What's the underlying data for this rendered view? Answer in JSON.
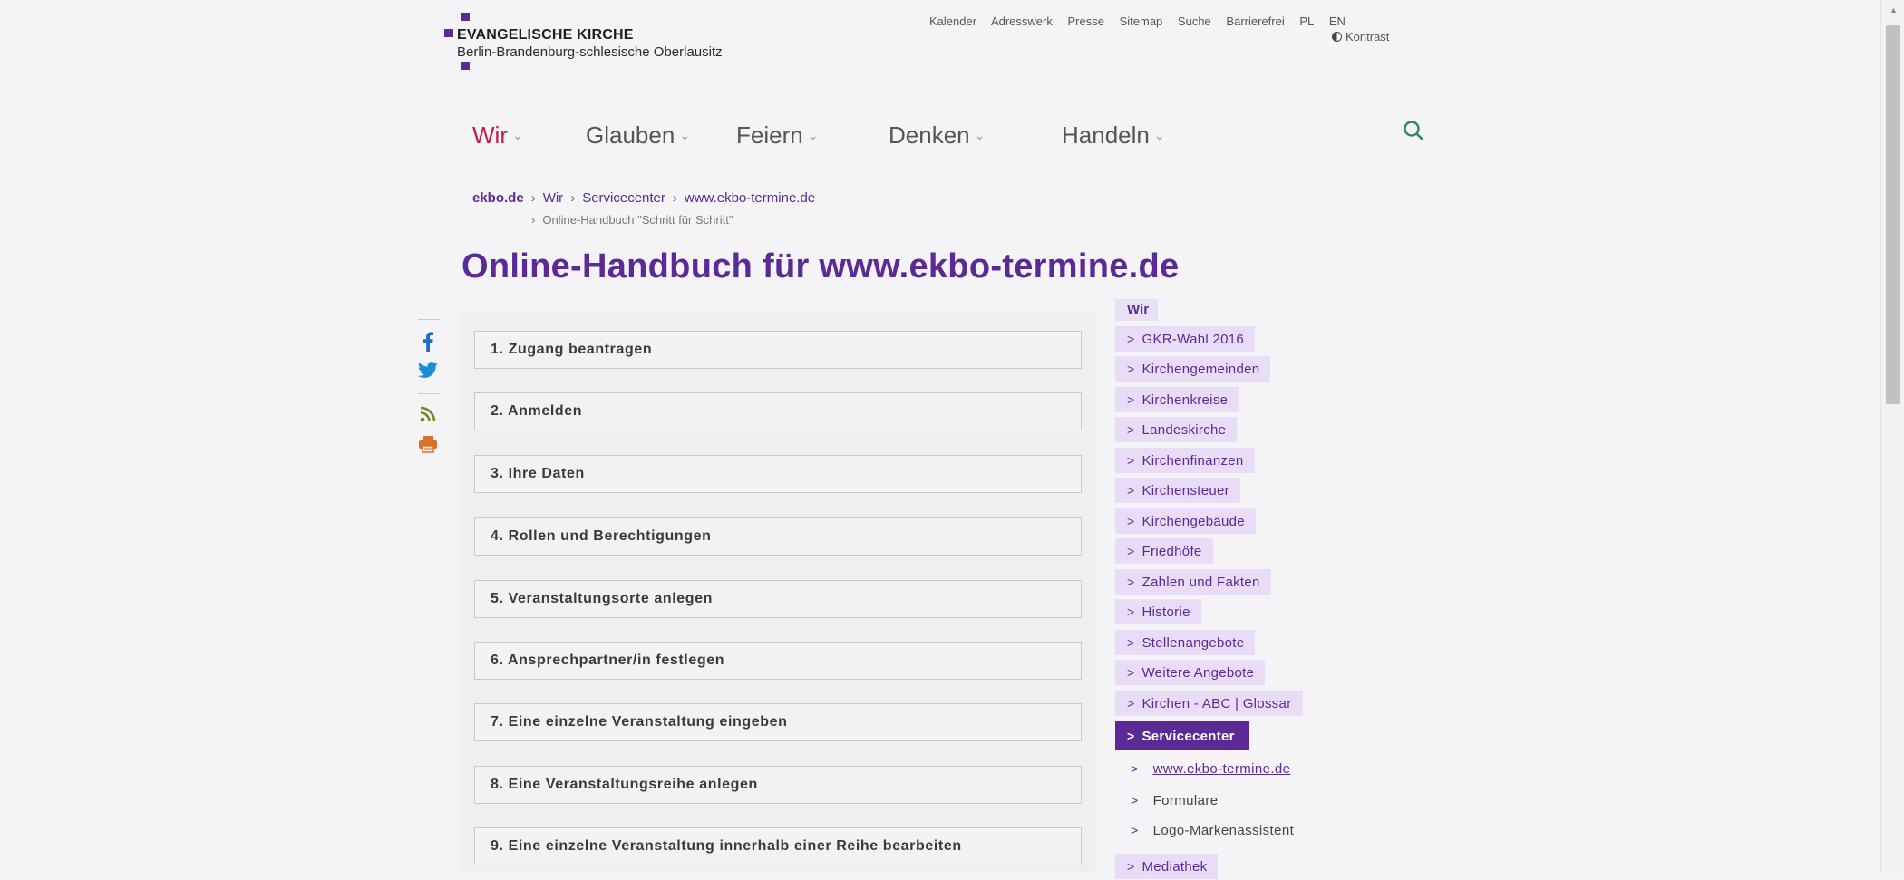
{
  "logo": {
    "name": "EVANGELISCHE KIRCHE",
    "subtitle": "Berlin-Brandenburg-schlesische Oberlausitz",
    "color": "#5b2a96"
  },
  "toplinks": [
    "Kalender",
    "Adresswerk",
    "Presse",
    "Sitemap",
    "Suche",
    "Barrierefrei",
    "PL",
    "EN"
  ],
  "kontrast": "Kontrast",
  "nav": [
    {
      "label": "Wir",
      "active": true
    },
    {
      "label": "Glauben",
      "active": false
    },
    {
      "label": "Feiern",
      "active": false
    },
    {
      "label": "Denken",
      "active": false
    },
    {
      "label": "Handeln",
      "active": false
    }
  ],
  "nav_chevron": "⌄",
  "search_icon": "search-icon",
  "breadcrumb": {
    "items": [
      "ekbo.de",
      "Wir",
      "Servicecenter",
      "www.ekbo-termine.de"
    ],
    "sep": "›",
    "current": "Online-Handbuch \"Schritt für Schritt\""
  },
  "page_title": "Online-Handbuch für www.ekbo-termine.de",
  "social_icons": [
    "facebook-icon",
    "twitter-icon",
    "rss-icon",
    "print-icon"
  ],
  "accordion": [
    "1. Zugang beantragen",
    "2. Anmelden",
    "3. Ihre Daten",
    "4. Rollen und Berechtigungen",
    "5. Veranstaltungsorte anlegen",
    "6. Ansprechpartner/in festlegen",
    "7. Eine einzelne Veranstaltung eingeben",
    "8. Eine Veranstaltungsreihe anlegen",
    "9. Eine einzelne Veranstaltung innerhalb einer Reihe bearbeiten"
  ],
  "sidebar": {
    "title": "Wir",
    "arrow": ">",
    "items": [
      "GKR-Wahl 2016",
      "Kirchengemeinden",
      "Kirchenkreise",
      "Landeskirche",
      "Kirchenfinanzen",
      "Kirchensteuer",
      "Kirchengebäude",
      "Friedhöfe",
      "Zahlen und Fakten",
      "Historie",
      "Stellenangebote",
      "Weitere Angebote",
      "Kirchen - ABC | Glossar"
    ],
    "active": "Servicecenter",
    "subitems": [
      "www.ekbo-termine.de",
      "Formulare",
      "Logo-Markenassistent"
    ],
    "after": "Mediathek"
  },
  "colors": {
    "accent": "#5b2a96",
    "active_nav": "#c41c4a",
    "search": "#2e8b57"
  }
}
